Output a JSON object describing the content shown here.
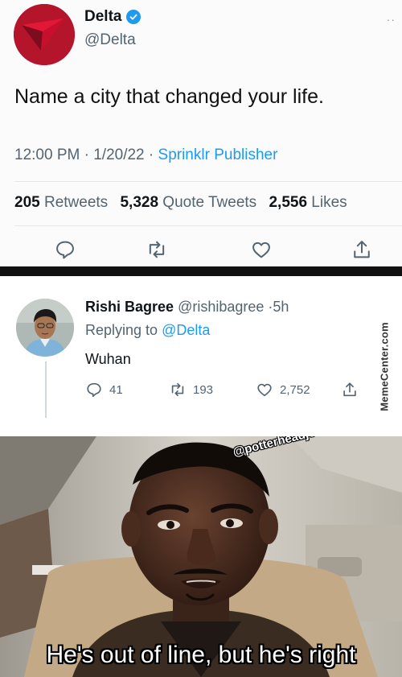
{
  "tweet": {
    "author_name": "Delta",
    "author_handle": "@Delta",
    "text": "Name a city that changed your life.",
    "time": "12:00 PM",
    "date": "1/20/22",
    "source": "Sprinklr Publisher",
    "retweets_count": "205",
    "retweets_label": "Retweets",
    "quotes_count": "5,328",
    "quotes_label": "Quote Tweets",
    "likes_count": "2,556",
    "likes_label": "Likes"
  },
  "reply": {
    "author_name": "Rishi Bagree",
    "author_handle": "@rishibagree",
    "age": "5h",
    "replying_prefix": "Replying to",
    "replying_to": "@Delta",
    "text": "Wuhan",
    "replies_count": "41",
    "retweets_count": "193",
    "likes_count": "2,752"
  },
  "watermark": "MemeCenter.com",
  "meme": {
    "credit": "@potterheadjocelyn",
    "caption": "He's out of line, but he's right"
  },
  "colors": {
    "delta_red": "#b5152b",
    "twitter_blue": "#1d9bf0",
    "muted_gray": "#536471"
  },
  "icons": [
    "verified-badge-icon",
    "reply-icon",
    "retweet-icon",
    "like-icon",
    "share-icon",
    "more-icon"
  ]
}
